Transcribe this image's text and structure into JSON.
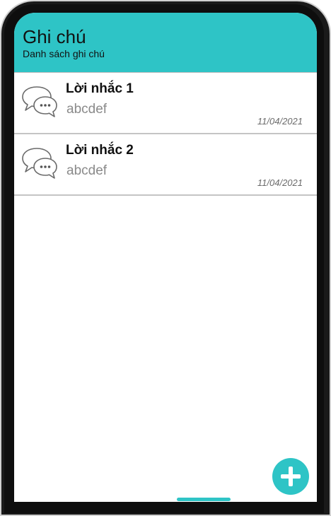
{
  "header": {
    "title": "Ghi chú",
    "subtitle": "Danh sách ghi chú"
  },
  "notes": [
    {
      "title": "Lời nhắc 1",
      "body": "abcdef",
      "date": "11/04/2021",
      "icon": "chat-bubbles-icon"
    },
    {
      "title": "Lời nhắc 2",
      "body": "abcdef",
      "date": "11/04/2021",
      "icon": "chat-bubbles-icon"
    }
  ],
  "fab": {
    "icon": "plus-icon"
  },
  "colors": {
    "accent": "#2ec4c6",
    "frame": "#1a1a1a"
  }
}
